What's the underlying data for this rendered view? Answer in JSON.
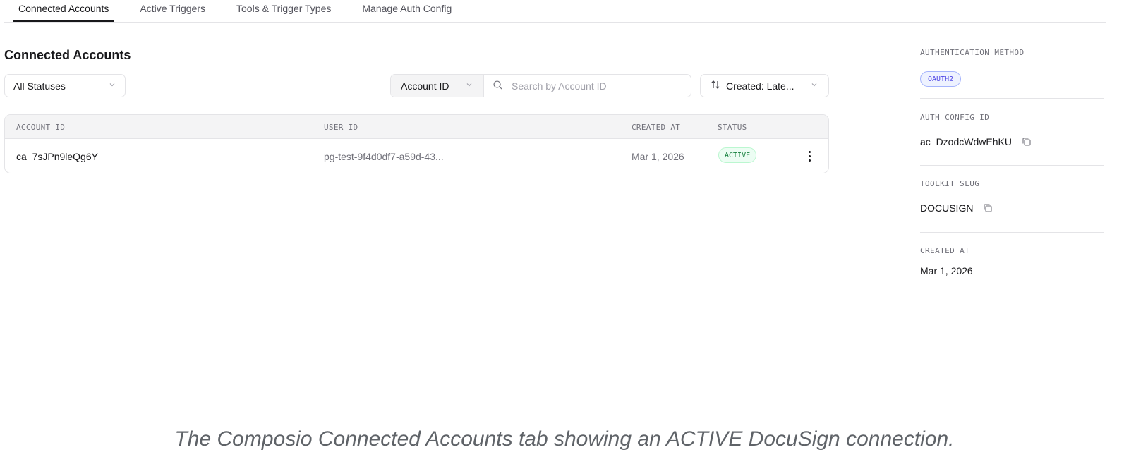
{
  "tabs": [
    {
      "label": "Connected Accounts",
      "active": true
    },
    {
      "label": "Active Triggers",
      "active": false
    },
    {
      "label": "Tools & Trigger Types",
      "active": false
    },
    {
      "label": "Manage Auth Config",
      "active": false
    }
  ],
  "main": {
    "title": "Connected Accounts",
    "filters": {
      "status_value": "All Statuses",
      "search_type": "Account ID",
      "search_placeholder": "Search by Account ID",
      "sort_value": "Created: Late..."
    },
    "table": {
      "headers": [
        "ACCOUNT ID",
        "USER ID",
        "CREATED AT",
        "STATUS"
      ],
      "rows": [
        {
          "account_id": "ca_7sJPn9leQg6Y",
          "user_id": "pg-test-9f4d0df7-a59d-43...",
          "created_at": "Mar 1, 2026",
          "status": "ACTIVE"
        }
      ]
    }
  },
  "panel": {
    "auth_method_label": "AUTHENTICATION METHOD",
    "auth_method_value": "OAUTH2",
    "auth_config_id_label": "AUTH CONFIG ID",
    "auth_config_id_value": "ac_DzodcWdwEhKU",
    "toolkit_slug_label": "TOOLKIT SLUG",
    "toolkit_slug_value": "DOCUSIGN",
    "created_at_label": "CREATED AT",
    "created_at_value": "Mar 1, 2026"
  },
  "caption": "The Composio Connected Accounts tab showing an ACTIVE DocuSign connection.",
  "colors": {
    "active_status_green": "#15803d",
    "oauth_badge_indigo": "#4f46e5"
  }
}
